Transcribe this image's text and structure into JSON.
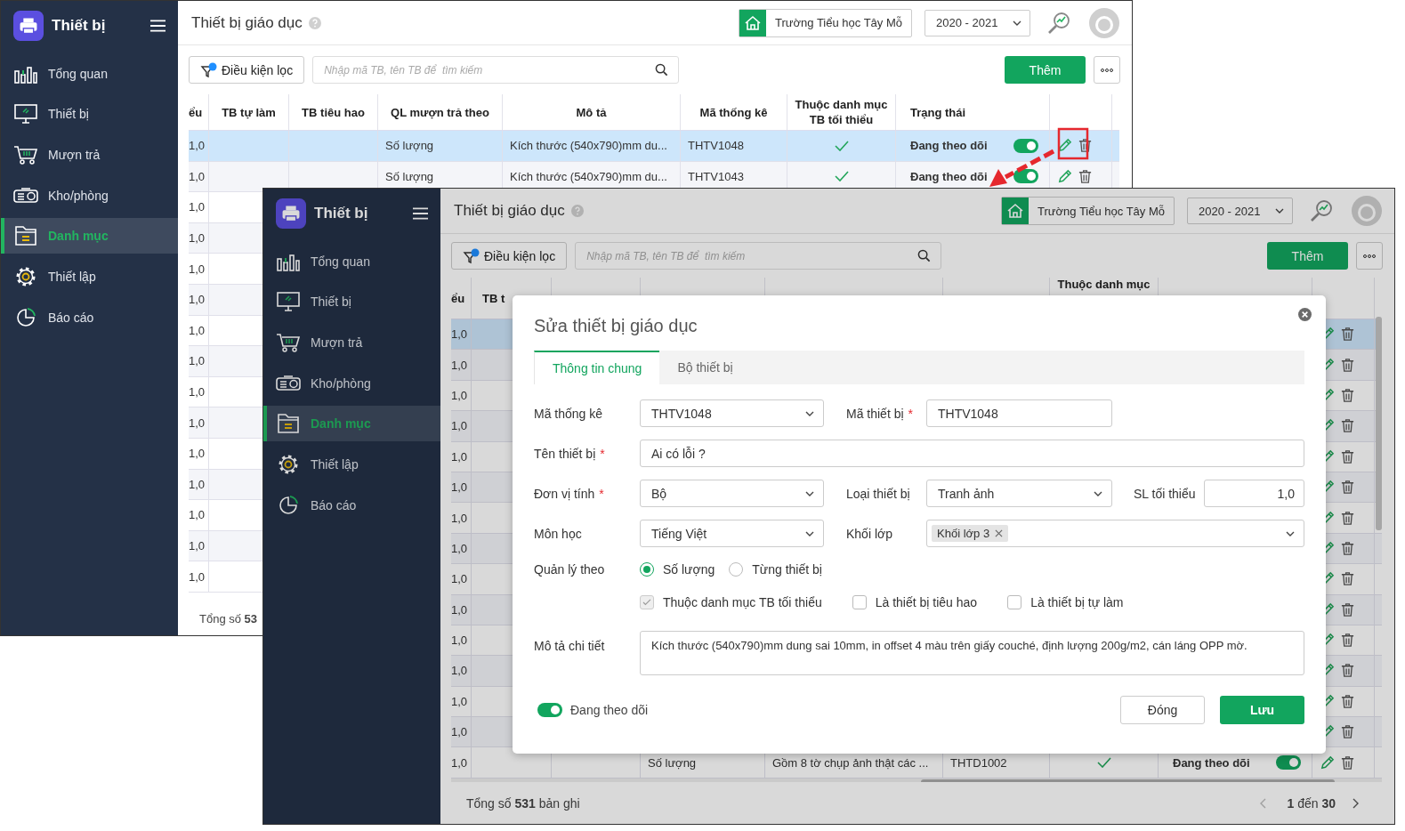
{
  "windows": [
    {
      "app_name": "Thiết bị",
      "sidebar": [
        {
          "label": "Tổng quan",
          "selected": false
        },
        {
          "label": "Thiết bị",
          "selected": false
        },
        {
          "label": "Mượn trả",
          "selected": false
        },
        {
          "label": "Kho/phòng",
          "selected": false
        },
        {
          "label": "Danh mục",
          "selected": true
        },
        {
          "label": "Thiết lập",
          "selected": false
        },
        {
          "label": "Báo cáo",
          "selected": false
        }
      ],
      "page_title": "Thiết bị giáo dục",
      "school": "Trường Tiểu học Tây Mỗ",
      "year": "2020 - 2021",
      "filter_button": "Điều kiện lọc",
      "search": {
        "placeholder": "Nhập mã TB, tên TB để  tìm kiếm"
      },
      "add_button": "Thêm",
      "table": {
        "columns": [
          {
            "label": "ểu"
          },
          {
            "label": "TB tự làm"
          },
          {
            "label": "TB tiêu hao"
          },
          {
            "label": "QL mượn trả theo"
          },
          {
            "label": "Mô tả"
          },
          {
            "label": "Mã thống kê"
          },
          {
            "label": "Thuộc danh mục TB tối thiểu"
          },
          {
            "label": "Trạng thái"
          },
          {}
        ],
        "rows": [
          {
            "selected": true,
            "qty": "1,0",
            "manage_by": "Số lượng",
            "description": "Kích thước (540x790)mm du...",
            "code": "THTV1048",
            "in_min_list": true,
            "status": "Đang theo dõi",
            "tracking": true,
            "actions": true
          },
          {
            "selected": false,
            "qty": "1,0",
            "manage_by": "Số lượng",
            "description": "Kích thước (540x790)mm du...",
            "code": "THTV1043",
            "in_min_list": true,
            "status": "Đang theo dõi",
            "tracking": true,
            "actions": true
          },
          {
            "selected": false,
            "qty": "1,0"
          },
          {
            "selected": false,
            "qty": "1,0"
          },
          {
            "selected": false,
            "qty": "1,0"
          },
          {
            "selected": false,
            "qty": "1,0"
          },
          {
            "selected": false,
            "qty": "1,0"
          },
          {
            "selected": false,
            "qty": "1,0"
          },
          {
            "selected": false,
            "qty": "1,0"
          },
          {
            "selected": false,
            "qty": "1,0"
          },
          {
            "selected": false,
            "qty": "1,0"
          },
          {
            "selected": false,
            "qty": "1,0"
          },
          {
            "selected": false,
            "qty": "1,0"
          },
          {
            "selected": false,
            "qty": "1,0"
          },
          {
            "selected": false,
            "qty": "1,0"
          }
        ]
      },
      "total": "Tổng số **53**"
    },
    {
      "app_name": "Thiết bị",
      "sidebar": [
        {
          "label": "Tổng quan",
          "selected": false
        },
        {
          "label": "Thiết bị",
          "selected": false
        },
        {
          "label": "Mượn trả",
          "selected": false
        },
        {
          "label": "Kho/phòng",
          "selected": false
        },
        {
          "label": "Danh mục",
          "selected": true
        },
        {
          "label": "Thiết lập",
          "selected": false
        },
        {
          "label": "Báo cáo",
          "selected": false
        }
      ],
      "page_title": "Thiết bị giáo dục",
      "school": "Trường Tiểu học Tây Mỗ",
      "year": "2020 - 2021",
      "filter_button": "Điều kiện lọc",
      "search": {
        "placeholder": "Nhập mã TB, tên TB để  tìm kiếm"
      },
      "add_button": "Thêm",
      "table": {
        "columns": [
          {
            "label": "ểu"
          },
          {
            "label": "TB t"
          },
          {},
          {},
          {},
          {},
          {
            "label": "Thuộc danh mục"
          },
          {},
          {}
        ],
        "rows": [
          {
            "selected": true,
            "qty": "1,0",
            "actions": true
          },
          {
            "selected": false,
            "qty": "1,0",
            "actions": true
          },
          {
            "selected": false,
            "qty": "1,0",
            "actions": true
          },
          {
            "selected": false,
            "qty": "1,0",
            "actions": true
          },
          {
            "selected": false,
            "qty": "1,0",
            "actions": true
          },
          {
            "selected": false,
            "qty": "1,0",
            "actions": true
          },
          {
            "selected": false,
            "qty": "1,0",
            "actions": true
          },
          {
            "selected": false,
            "qty": "1,0",
            "actions": true
          },
          {
            "selected": false,
            "qty": "1,0",
            "actions": true
          },
          {
            "selected": false,
            "qty": "1,0",
            "actions": true
          },
          {
            "selected": false,
            "qty": "1,0",
            "actions": true
          },
          {
            "selected": false,
            "qty": "1,0",
            "actions": true
          },
          {
            "selected": false,
            "qty": "1,0",
            "actions": true
          },
          {
            "selected": false,
            "qty": "1,0",
            "actions": true
          },
          {
            "selected": false,
            "qty": "1,0",
            "manage_by": "Số lượng",
            "description": "Gồm 8 tờ chụp ảnh thật các ...",
            "code": "THTD1002",
            "in_min_list": true,
            "status": "Đang theo dõi",
            "tracking": true,
            "actions": true
          }
        ]
      },
      "total": "Tổng số **531** bản ghi",
      "pagination": "**1** đến **30**",
      "dialog": {
        "title": "Sửa thiết bị giáo dục",
        "tabs": [
          {
            "label": "Thông tin chung",
            "selected": true
          },
          {
            "label": "Bộ thiết bị",
            "selected": false
          }
        ],
        "form_rows": [
          [
            {
              "label": "Mã thống kê",
              "kind": "select",
              "value": "THTV1048"
            },
            {
              "label": "Mã thiết bị",
              "required_mark": "*",
              "kind": "input",
              "value": "THTV1048"
            }
          ],
          [
            {
              "label": "Tên thiết bị",
              "required_mark": "*",
              "kind": "input",
              "value": "Ai có lỗi ?"
            }
          ],
          [
            {
              "label": "Đơn vị tính",
              "required_mark": "*",
              "kind": "select",
              "value": "Bộ"
            },
            {
              "label": "Loại thiết bị",
              "kind": "select",
              "value": "Tranh ảnh"
            },
            {
              "label": "SL tối thiểu",
              "kind": "number",
              "value": "1,0"
            }
          ],
          [
            {
              "label": "Môn học",
              "kind": "select",
              "value": "Tiếng Việt"
            },
            {
              "label": "Khối lớp",
              "kind": "tags",
              "tags": [
                "Khối lớp 3"
              ]
            }
          ]
        ],
        "manage_by": {
          "label": "Quản lý theo",
          "options": [
            {
              "label": "Số lượng",
              "selected": true
            },
            {
              "label": "Từng thiết bị",
              "selected": false
            }
          ]
        },
        "flags": [
          {
            "label": "Thuộc danh mục TB tối thiểu",
            "checked": true,
            "disabled": true
          },
          {
            "label": "Là thiết bị tiêu hao",
            "checked": false,
            "disabled": false
          },
          {
            "label": "Là thiết bị tự làm",
            "checked": false,
            "disabled": false
          }
        ],
        "description": {
          "label": "Mô tả chi tiết",
          "value": "Kích thước (540x790)mm dung sai 10mm, in offset 4 màu trên giấy couché, định lượng 200g/m2, cán láng OPP mờ."
        },
        "tracking": {
          "label": "Đang theo dõi",
          "on": true
        },
        "buttons": [
          {
            "label": "Đóng",
            "kind": "secondary"
          },
          {
            "label": "Lưu",
            "kind": "primary"
          }
        ]
      }
    }
  ]
}
